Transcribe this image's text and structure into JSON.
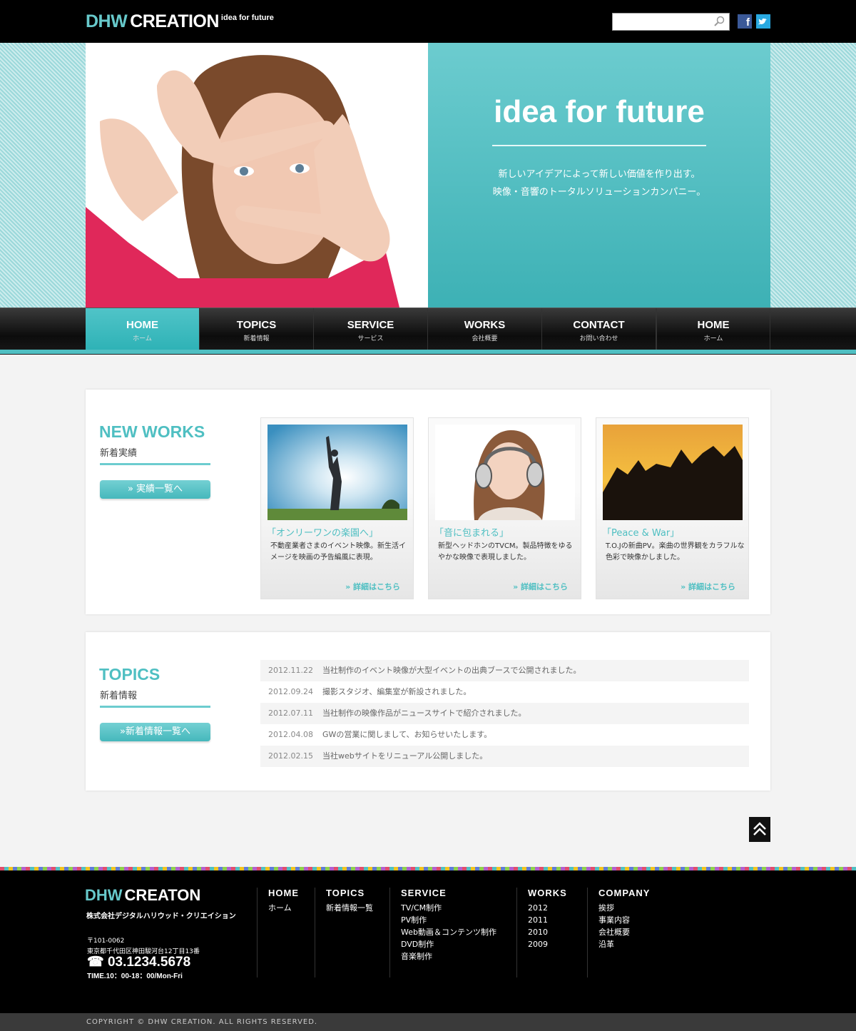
{
  "header": {
    "logo_part1": "DHW",
    "logo_part2": "CREATION",
    "logo_tagline": "idea for future",
    "search_placeholder": "",
    "social": [
      "facebook-icon",
      "twitter-icon"
    ]
  },
  "hero": {
    "title": "idea for future",
    "line1": "新しいアイデアによって新しい価値を作り出す。",
    "line2": "映像・音響のトータルソリューションカンパニー。"
  },
  "nav": [
    {
      "en": "HOME",
      "jp": "ホーム"
    },
    {
      "en": "TOPICS",
      "jp": "新着情報"
    },
    {
      "en": "SERVICE",
      "jp": "サービス"
    },
    {
      "en": "WORKS",
      "jp": "会社概要"
    },
    {
      "en": "CONTACT",
      "jp": "お問い合わせ"
    },
    {
      "en": "HOME",
      "jp": "ホーム"
    }
  ],
  "works": {
    "title": "NEW WORKS",
    "subtitle": "新着実績",
    "button": "»  実績一覧へ",
    "items": [
      {
        "title": "「オンリーワンの楽園へ」",
        "desc": "不動産業者さまのイベント映像。新生活イメージを映画の予告編風に表現。",
        "link": "»  詳細はこちら"
      },
      {
        "title": "「音に包まれる」",
        "desc": "新型ヘッドホンのTVCM。製品特徴をゆるやかな映像で表現しました。",
        "link": "»  詳細はこちら"
      },
      {
        "title": "「Peace & War」",
        "desc": "T.O.Jの新曲PV。楽曲の世界観をカラフルな色彩で映像かしました。",
        "link": "»  詳細はこちら"
      }
    ]
  },
  "topics": {
    "title": "TOPICS",
    "subtitle": "新着情報",
    "button": "»新着情報一覧へ",
    "items": [
      {
        "date": "2012.11.22",
        "text": "当社制作のイベント映像が大型イベントの出典ブースで公開されました。"
      },
      {
        "date": "2012.09.24",
        "text": "撮影スタジオ、編集室が新設されました。"
      },
      {
        "date": "2012.07.11",
        "text": "当社制作の映像作品がニュースサイトで紹介されました。"
      },
      {
        "date": "2012.04.08",
        "text": "GWの営業に関しまして、お知らせいたします。"
      },
      {
        "date": "2012.02.15",
        "text": "当社webサイトをリニューアル公開しました。"
      }
    ]
  },
  "footer": {
    "logo_part1": "DHW",
    "logo_part2": "CREATON",
    "company": "株式会社デジタルハリウッド・クリエイション",
    "postal": "〒101-0062",
    "address": "東京都千代田区神田駿河台12丁目13番",
    "tel": "☎ 03.1234.5678",
    "time": "TIME.10：00-18：00/Mon-Fri",
    "columns": [
      {
        "heading": "HOME",
        "items": [
          "ホーム"
        ]
      },
      {
        "heading": "TOPICS",
        "items": [
          "新着情報一覧"
        ]
      },
      {
        "heading": "SERVICE",
        "items": [
          "TV/CM制作",
          "PV制作",
          "Web動画＆コンテンツ制作",
          "DVD制作",
          "音楽制作"
        ]
      },
      {
        "heading": "WORKS",
        "items": [
          "2012",
          "2011",
          "2010",
          "2009"
        ]
      },
      {
        "heading": "COMPANY",
        "items": [
          "挨拶",
          "事業内容",
          "会社概要",
          "沿革"
        ]
      }
    ],
    "copyright": "COPYRIGHT © DHW CREATION. ALL RIGHTS RESERVED."
  },
  "colors": {
    "accent": "#4fbfc2",
    "dark": "#000000"
  }
}
